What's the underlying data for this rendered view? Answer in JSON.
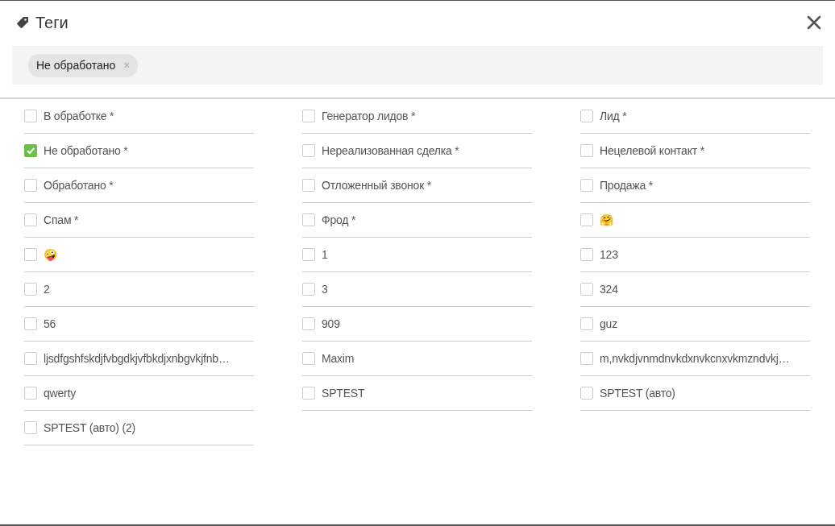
{
  "dialog": {
    "title": "Теги"
  },
  "selected_tags": [
    {
      "label": "Не обработано",
      "remove": "×"
    }
  ],
  "tags": [
    {
      "label": "В обработке *",
      "checked": false
    },
    {
      "label": "Генератор лидов *",
      "checked": false
    },
    {
      "label": "Лид *",
      "checked": false
    },
    {
      "label": "Не обработано *",
      "checked": true
    },
    {
      "label": "Нереализованная сделка *",
      "checked": false
    },
    {
      "label": "Нецелевой контакт *",
      "checked": false
    },
    {
      "label": "Обработано *",
      "checked": false
    },
    {
      "label": "Отложенный звонок *",
      "checked": false
    },
    {
      "label": "Продажа *",
      "checked": false
    },
    {
      "label": "Спам *",
      "checked": false
    },
    {
      "label": "Фрод *",
      "checked": false
    },
    {
      "label": "🤗",
      "checked": false
    },
    {
      "label": "🤪",
      "checked": false
    },
    {
      "label": "1",
      "checked": false
    },
    {
      "label": "123",
      "checked": false
    },
    {
      "label": "2",
      "checked": false
    },
    {
      "label": "3",
      "checked": false
    },
    {
      "label": "324",
      "checked": false
    },
    {
      "label": "56",
      "checked": false
    },
    {
      "label": "909",
      "checked": false
    },
    {
      "label": "guz",
      "checked": false
    },
    {
      "label": "ljsdfgshfskdjfvbgdkjvfbkdjxnbgvkjfnb…",
      "checked": false
    },
    {
      "label": "Maxim",
      "checked": false
    },
    {
      "label": "m,nvkdjvnmdnvkdxnvkcnxvkmzndvkj…",
      "checked": false
    },
    {
      "label": "qwerty",
      "checked": false
    },
    {
      "label": "SPTEST",
      "checked": false
    },
    {
      "label": "SPTEST (авто)",
      "checked": false
    },
    {
      "label": "SPTEST (авто) (2)",
      "checked": false
    }
  ]
}
